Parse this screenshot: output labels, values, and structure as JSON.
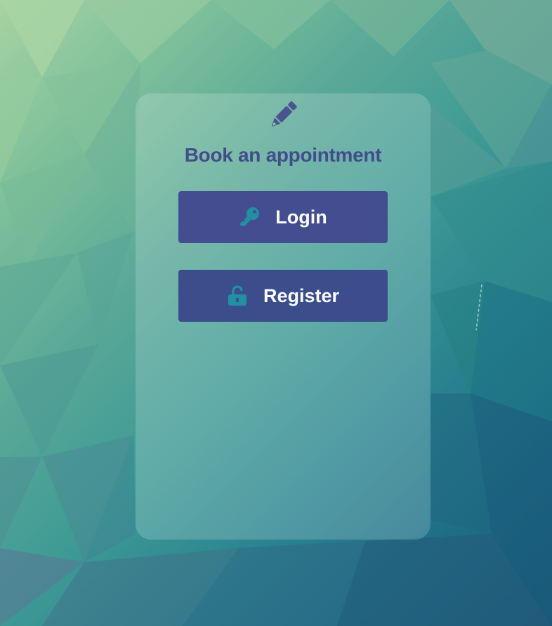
{
  "card": {
    "title": "Book an appointment",
    "title_icon": "pencil-icon"
  },
  "buttons": {
    "login": {
      "label": "Login",
      "icon": "key-icon"
    },
    "register": {
      "label": "Register",
      "icon": "unlock-icon"
    }
  },
  "colors": {
    "title": "#424d8c",
    "button_bg": "#3d4a8c",
    "button_text": "#ffffff",
    "icon_accent": "#1f8fa3"
  }
}
